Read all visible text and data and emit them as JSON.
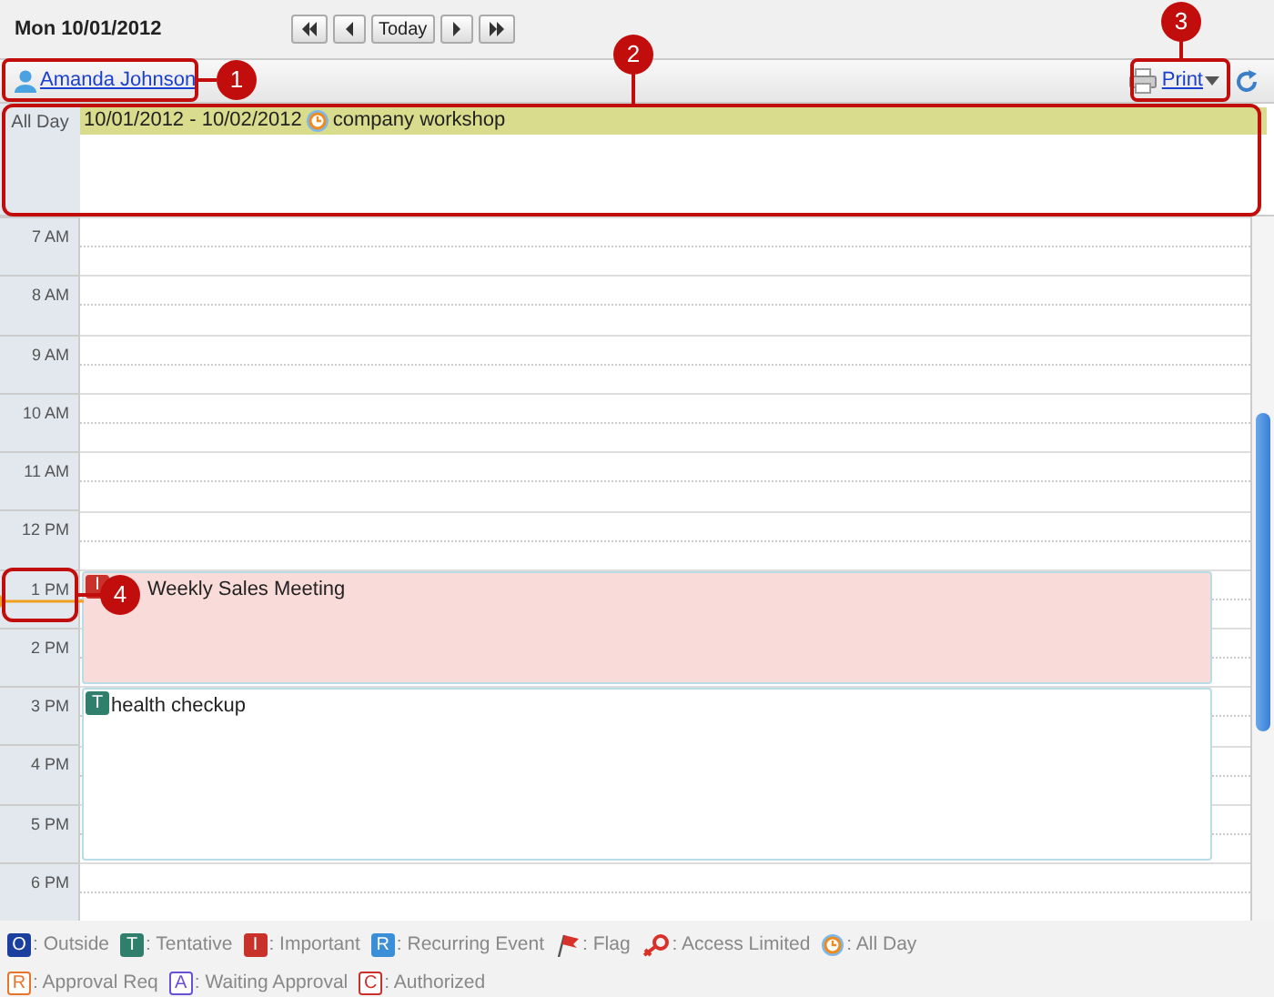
{
  "header": {
    "date": "Mon 10/01/2012",
    "nav": [
      {
        "kind": "first"
      },
      {
        "kind": "prev"
      },
      {
        "kind": "today",
        "label": "Today"
      },
      {
        "kind": "next"
      },
      {
        "kind": "last"
      }
    ]
  },
  "toolbar": {
    "user": "Amanda Johnson",
    "print": "Print"
  },
  "all_day": {
    "label": "All Day",
    "events": [
      {
        "dates": "10/01/2012 - 10/02/2012",
        "title": "company workshop"
      }
    ]
  },
  "hours": [
    "7 AM",
    "8 AM",
    "9 AM",
    "10 AM",
    "11 AM",
    "12 PM",
    "1 PM",
    "2 PM",
    "3 PM",
    "4 PM",
    "5 PM",
    "6 PM"
  ],
  "events": [
    {
      "title": "Weekly Sales Meeting",
      "color": "#f9dbd9",
      "badges": [
        {
          "letter": "I",
          "color": "#c8322a"
        }
      ]
    },
    {
      "title": "health checkup",
      "color": "#ffffff",
      "badges": [
        {
          "letter": "T",
          "color": "#2f7f6c"
        }
      ]
    }
  ],
  "legend": [
    {
      "kind": "solid",
      "letter": "O",
      "color": "#1b3f9e",
      "label": ": Outside"
    },
    {
      "kind": "solid",
      "letter": "T",
      "color": "#2f7f6c",
      "label": ": Tentative"
    },
    {
      "kind": "solid",
      "letter": "I",
      "color": "#c8322a",
      "label": ": Important"
    },
    {
      "kind": "solid",
      "letter": "R",
      "color": "#3a8fd8",
      "label": ": Recurring Event"
    },
    {
      "kind": "flag",
      "label": ": Flag"
    },
    {
      "kind": "key",
      "label": ": Access Limited"
    },
    {
      "kind": "allday",
      "label": ": All Day"
    },
    {
      "kind": "outline",
      "letter": "R",
      "color": "#e8742a",
      "label": ": Approval Req"
    },
    {
      "kind": "outline",
      "letter": "A",
      "color": "#6a4fd8",
      "label": ": Waiting Approval"
    },
    {
      "kind": "outline",
      "letter": "C",
      "color": "#c8322a",
      "label": ": Authorized"
    }
  ],
  "callouts": [
    "1",
    "2",
    "3",
    "4"
  ]
}
